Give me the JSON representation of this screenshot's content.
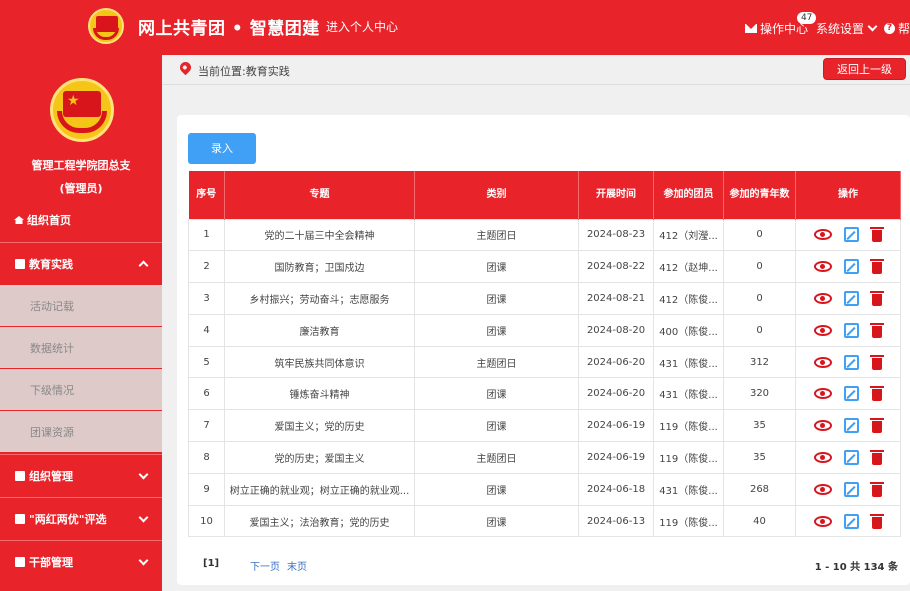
{
  "header": {
    "site_title": "网上共青团 • 智慧团建",
    "personal_center": "进入个人中心",
    "ops_center": "操作中心",
    "ops_badge": "47",
    "system_settings": "系统设置",
    "help": "帮"
  },
  "sidebar": {
    "org_name": "管理工程学院团总支",
    "role": "(管理员)",
    "home": "组织首页",
    "menus": [
      {
        "label": "教育实践",
        "expanded": true
      },
      {
        "label": "组织管理"
      },
      {
        "label": "\"两红两优\"评选"
      },
      {
        "label": "干部管理"
      }
    ],
    "sub_items": [
      "活动记载",
      "数据统计",
      "下级情况",
      "团课资源"
    ]
  },
  "breadcrumb": {
    "text": "当前位置:教育实践",
    "back": "返回上一级"
  },
  "toolbar": {
    "enter": "录入"
  },
  "table": {
    "headers": [
      "序号",
      "专题",
      "类别",
      "开展时间",
      "参加的团员",
      "参加的青年数",
      "操作"
    ],
    "rows": [
      [
        "1",
        "党的二十届三中全会精神",
        "主题团日",
        "2024-08-23",
        "412（刘瀅...",
        "0"
      ],
      [
        "2",
        "国防教育；卫国戍边",
        "团课",
        "2024-08-22",
        "412（赵坤...",
        "0"
      ],
      [
        "3",
        "乡村振兴；劳动奋斗；志愿服务",
        "团课",
        "2024-08-21",
        "412（陈俊...",
        "0"
      ],
      [
        "4",
        "廉洁教育",
        "团课",
        "2024-08-20",
        "400（陈俊...",
        "0"
      ],
      [
        "5",
        "筑牢民族共同体意识",
        "主题团日",
        "2024-06-20",
        "431（陈俊...",
        "312"
      ],
      [
        "6",
        "锤炼奋斗精神",
        "团课",
        "2024-06-20",
        "431（陈俊...",
        "320"
      ],
      [
        "7",
        "爱国主义；党的历史",
        "团课",
        "2024-06-19",
        "119（陈俊...",
        "35"
      ],
      [
        "8",
        "党的历史；爱国主义",
        "主题团日",
        "2024-06-19",
        "119（陈俊...",
        "35"
      ],
      [
        "9",
        "树立正确的就业观；树立正确的就业观...",
        "团课",
        "2024-06-18",
        "431（陈俊...",
        "268"
      ],
      [
        "10",
        "爱国主义；法治教育；党的历史",
        "团课",
        "2024-06-13",
        "119（陈俊...",
        "40"
      ]
    ]
  },
  "pager": {
    "current": "[1]",
    "next": "下一页",
    "last": "末页",
    "total": "1 - 10 共 134 条"
  },
  "colors": {
    "brand_red": "#e8232a",
    "button_blue": "#3fa0f5"
  }
}
